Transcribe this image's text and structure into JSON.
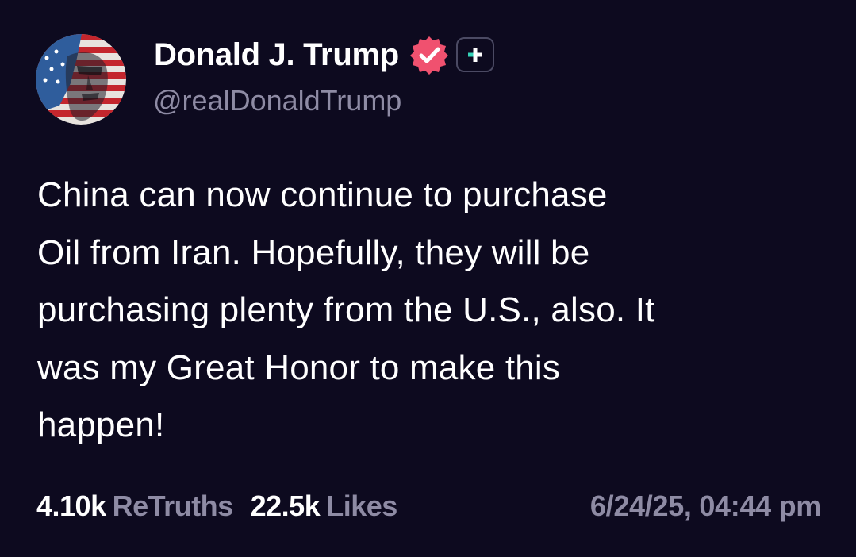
{
  "author": {
    "display_name": "Donald J. Trump",
    "handle": "@realDonaldTrump",
    "avatar": "profile-avatar-flag-portrait",
    "verified_icon": "verified-badge-icon",
    "plus_icon": "plus-badge-icon"
  },
  "post": {
    "lines": [
      "China can now continue to purchase",
      "Oil from Iran. Hopefully, they will be",
      "purchasing plenty from the U.S., also. It",
      "was my Great Honor to make this",
      "happen!"
    ]
  },
  "stats": {
    "retruths_count": "4.10k",
    "retruths_label": "ReTruths",
    "likes_count": "22.5k",
    "likes_label": "Likes"
  },
  "timestamp": "6/24/25, 04:44 pm",
  "colors": {
    "background": "#0d0a1f",
    "text_primary": "#ffffff",
    "text_secondary": "#8e8ba4",
    "verified_badge": "#f0516f",
    "plus_accent": "#35d3b8"
  }
}
